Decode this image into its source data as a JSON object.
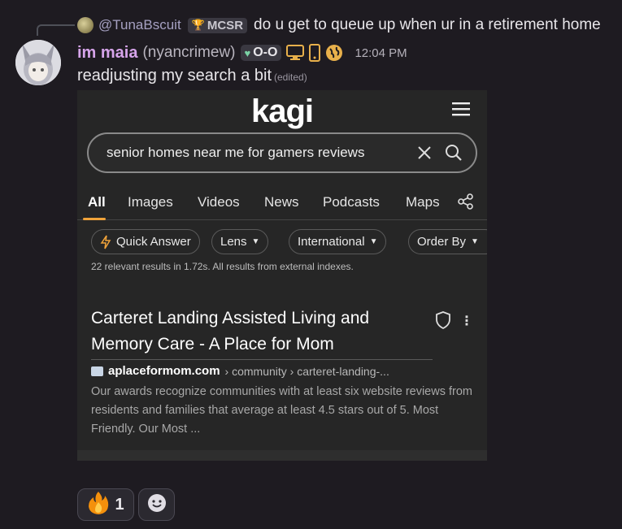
{
  "reply": {
    "author": "@TunaBscuit",
    "tag": "MCSR",
    "text": "do u get to queue up when ur in a retirement home"
  },
  "message": {
    "display_name": "im maia",
    "handle": "(nyancrimew)",
    "guild_tag": "O-O",
    "timestamp": "12:04 PM",
    "text": "readjusting my search a bit",
    "edited_label": "(edited)"
  },
  "screenshot": {
    "logo": "kagi",
    "search_query": "senior homes near me for gamers reviews",
    "tabs": [
      "All",
      "Images",
      "Videos",
      "News",
      "Podcasts",
      "Maps"
    ],
    "active_tab": "All",
    "filters": {
      "quick_answer": "Quick Answer",
      "lens": "Lens",
      "region": "International",
      "order": "Order By"
    },
    "results_meta": "22 relevant results in 1.72s. All results from external indexes.",
    "result": {
      "title": "Carteret Landing Assisted Living and Memory Care - A Place for Mom",
      "domain": "aplaceformom.com",
      "path": "› community › carteret-landing-...",
      "snippet": "Our awards recognize communities with at least six website reviews from residents and families that average at least 4.5 stars out of 5. Most Friendly. Our Most ..."
    }
  },
  "reactions": [
    {
      "icon": "fire-emoji",
      "count": "1"
    },
    {
      "icon": "add-reaction-icon",
      "count": ""
    }
  ],
  "colors": {
    "background": "#1e1b21",
    "username": "#d6a4ea",
    "accent": "#f0a33a"
  }
}
